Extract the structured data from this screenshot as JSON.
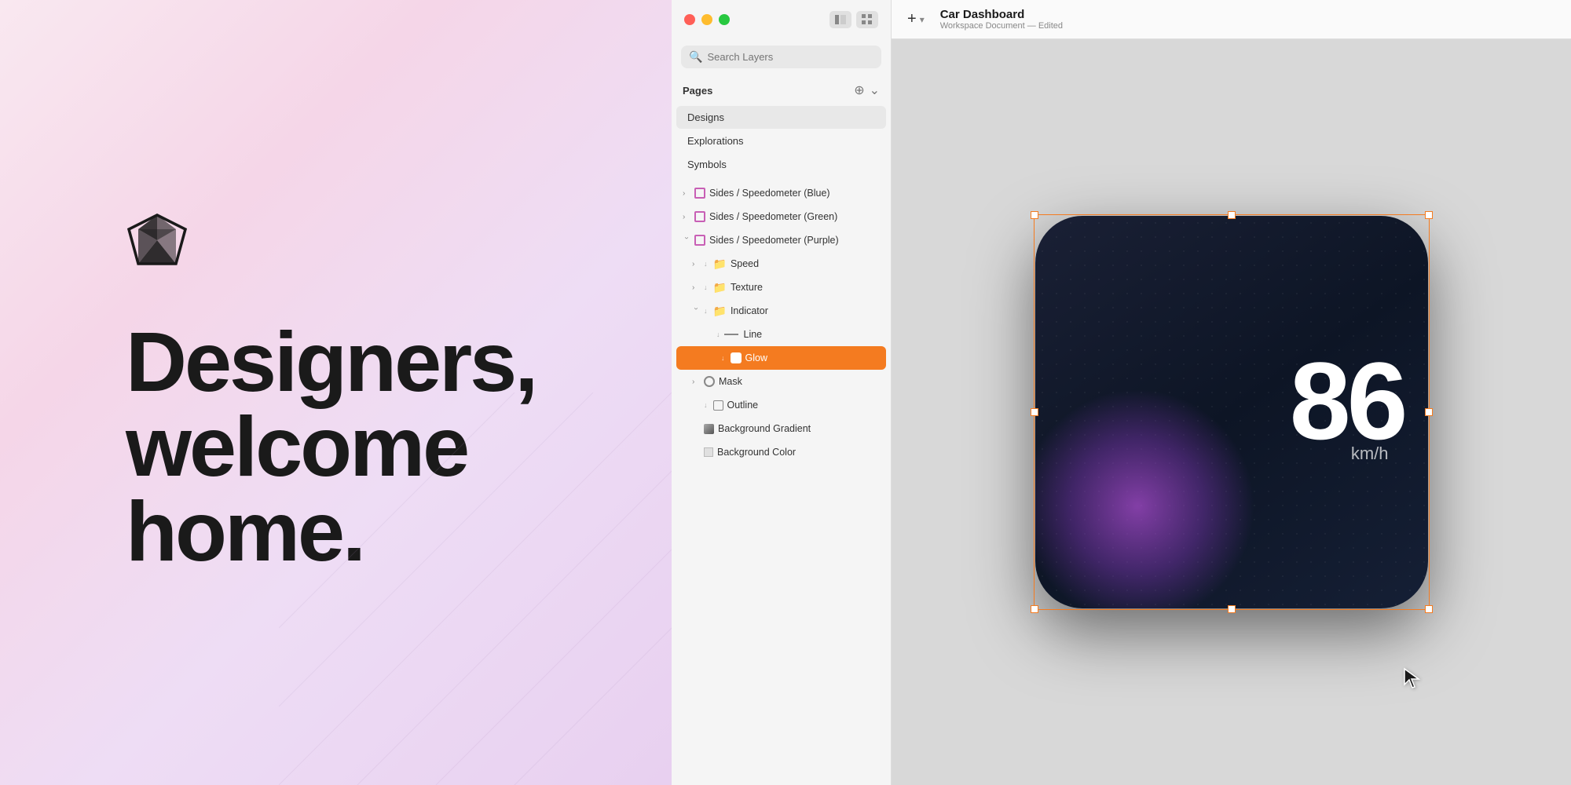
{
  "hero": {
    "title_line1": "Designers,",
    "title_line2": "welcome",
    "title_line3": "home."
  },
  "window": {
    "traffic_lights": {
      "close_label": "close",
      "minimize_label": "minimize",
      "maximize_label": "maximize"
    },
    "controls": {
      "icon_panel": "⬛",
      "grid_view": "⊞"
    }
  },
  "search": {
    "placeholder": "Search Layers"
  },
  "pages": {
    "label": "Pages",
    "add_icon": "+",
    "expand_icon": "⌄",
    "items": [
      {
        "name": "Designs",
        "active": true
      },
      {
        "name": "Explorations",
        "active": false
      },
      {
        "name": "Symbols",
        "active": false
      }
    ]
  },
  "layers": {
    "items": [
      {
        "indent": 0,
        "type": "artboard",
        "chevron": "›",
        "name": "Sides / Speedometer (Blue)",
        "override": false,
        "selected": false
      },
      {
        "indent": 0,
        "type": "artboard",
        "chevron": "›",
        "name": "Sides / Speedometer (Green)",
        "override": false,
        "selected": false
      },
      {
        "indent": 0,
        "type": "artboard",
        "chevron": "‹",
        "name": "Sides / Speedometer (Purple)",
        "override": false,
        "selected": false
      },
      {
        "indent": 1,
        "type": "folder",
        "chevron": "›",
        "name": "Speed",
        "override": true,
        "selected": false
      },
      {
        "indent": 1,
        "type": "folder",
        "chevron": "›",
        "name": "Texture",
        "override": true,
        "selected": false
      },
      {
        "indent": 1,
        "type": "folder",
        "chevron": "‹",
        "name": "Indicator",
        "override": true,
        "selected": false
      },
      {
        "indent": 2,
        "type": "line",
        "chevron": "",
        "name": "Line",
        "override": true,
        "selected": false
      },
      {
        "indent": 2,
        "type": "glow",
        "chevron": "",
        "name": "Glow",
        "override": true,
        "selected": true
      },
      {
        "indent": 1,
        "type": "oval",
        "chevron": "›",
        "name": "Mask",
        "override": false,
        "selected": false
      },
      {
        "indent": 1,
        "type": "outline",
        "chevron": "",
        "name": "Outline",
        "override": true,
        "selected": false
      },
      {
        "indent": 1,
        "type": "gradient",
        "chevron": "",
        "name": "Background Gradient",
        "override": false,
        "selected": false
      },
      {
        "indent": 1,
        "type": "color",
        "chevron": "",
        "name": "Background Color",
        "override": false,
        "selected": false
      }
    ]
  },
  "canvas": {
    "add_button_label": "+",
    "doc_title": "Car Dashboard",
    "doc_subtitle": "Workspace Document — Edited"
  },
  "speedometer": {
    "speed": "86",
    "unit": "km/h"
  }
}
